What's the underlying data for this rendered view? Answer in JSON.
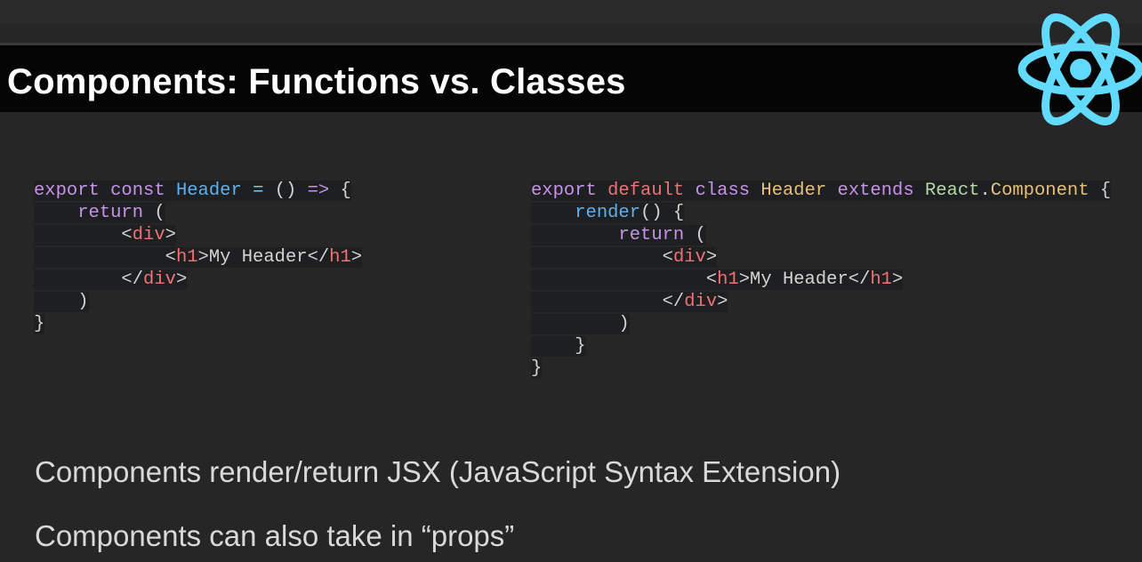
{
  "slide": {
    "title": "Components: Functions vs. Classes",
    "logo_icon": "react-atom-icon",
    "accent_color": "#61dafb"
  },
  "code_left": {
    "lines": [
      [
        [
          "purple",
          "export"
        ],
        [
          "plain",
          " "
        ],
        [
          "purple",
          "const"
        ],
        [
          "plain",
          " "
        ],
        [
          "blue",
          "Header"
        ],
        [
          "plain",
          " "
        ],
        [
          "cyan",
          "="
        ],
        [
          "plain",
          " () "
        ],
        [
          "purple",
          "=>"
        ],
        [
          "plain",
          " {"
        ]
      ],
      [
        [
          "plain",
          "    "
        ],
        [
          "purple",
          "return"
        ],
        [
          "plain",
          " ("
        ]
      ],
      [
        [
          "plain",
          "        <"
        ],
        [
          "red",
          "div"
        ],
        [
          "plain",
          ">"
        ]
      ],
      [
        [
          "plain",
          "            <"
        ],
        [
          "red",
          "h1"
        ],
        [
          "plain",
          ">My Header</"
        ],
        [
          "red",
          "h1"
        ],
        [
          "plain",
          ">"
        ]
      ],
      [
        [
          "plain",
          "        </"
        ],
        [
          "red",
          "div"
        ],
        [
          "plain",
          ">"
        ]
      ],
      [
        [
          "plain",
          "    )"
        ]
      ],
      [
        [
          "plain",
          "}"
        ]
      ]
    ]
  },
  "code_right": {
    "lines": [
      [
        [
          "purple",
          "export"
        ],
        [
          "plain",
          " "
        ],
        [
          "red",
          "default"
        ],
        [
          "plain",
          " "
        ],
        [
          "purple",
          "class"
        ],
        [
          "plain",
          " "
        ],
        [
          "yellow",
          "Header"
        ],
        [
          "plain",
          " "
        ],
        [
          "purple",
          "extends"
        ],
        [
          "plain",
          " "
        ],
        [
          "green",
          "React"
        ],
        [
          "plain",
          "."
        ],
        [
          "yellow",
          "Component"
        ],
        [
          "plain",
          " {"
        ]
      ],
      [
        [
          "plain",
          "    "
        ],
        [
          "blue",
          "render"
        ],
        [
          "plain",
          "() {"
        ]
      ],
      [
        [
          "plain",
          "        "
        ],
        [
          "purple",
          "return"
        ],
        [
          "plain",
          " ("
        ]
      ],
      [
        [
          "plain",
          "            <"
        ],
        [
          "red",
          "div"
        ],
        [
          "plain",
          ">"
        ]
      ],
      [
        [
          "plain",
          "                <"
        ],
        [
          "red",
          "h1"
        ],
        [
          "plain",
          ">My Header</"
        ],
        [
          "red",
          "h1"
        ],
        [
          "plain",
          ">"
        ]
      ],
      [
        [
          "plain",
          "            </"
        ],
        [
          "red",
          "div"
        ],
        [
          "plain",
          ">"
        ]
      ],
      [
        [
          "plain",
          "        )"
        ]
      ],
      [
        [
          "plain",
          "    }"
        ]
      ],
      [
        [
          "plain",
          "}"
        ]
      ]
    ]
  },
  "bullets": {
    "first": "Components render/return JSX (JavaScript Syntax Extension)",
    "second": "Components can also take in “props”"
  }
}
